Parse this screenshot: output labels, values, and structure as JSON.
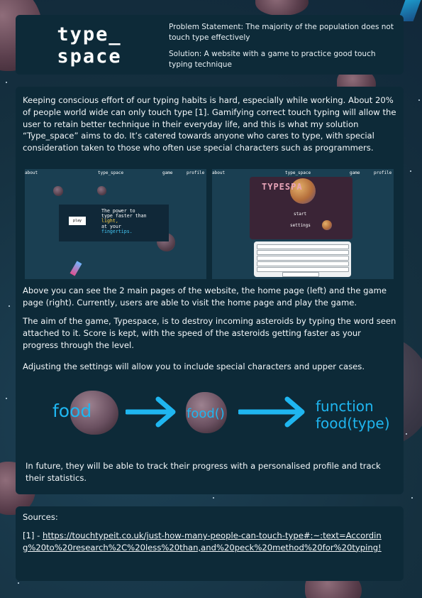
{
  "header": {
    "logo_line1": "type_",
    "logo_line2": "space",
    "problem": "Problem Statement: The majority of the population does not touch type effectively",
    "solution": "Solution: A website with a game to practice good touch typing technique"
  },
  "main": {
    "intro": "Keeping conscious effort of our typing habits is hard, especially while working.  About 20% of people world wide can only touch type [1]. Gamifying correct touch typing will allow the user to retain better technique in their everyday life, and this is what my solution “Type_space” aims to do. It’s catered towards anyone who cares to type, with special consideration taken to those who often use special characters such as programmers.",
    "home_shot": {
      "nav": [
        "about",
        "type_space",
        "game",
        "profile"
      ],
      "hero_line1": "The power to",
      "hero_line2": "type faster than",
      "hero_line3": "light,",
      "hero_line4": "at your",
      "hero_line5": "fingertips.",
      "play_button": "play"
    },
    "game_shot": {
      "nav": [
        "about",
        "type_space",
        "game",
        "profile"
      ],
      "title": "TYPESPA",
      "menu_start": "start",
      "menu_settings": "settings"
    },
    "para_pages": "Above you can see the 2 main pages of the website, the home page (left) and the game page (right). Currently, users are able to visit the home page and play the game.",
    "para_aim": "The aim of the game, Typespace, is to destroy incoming asteroids by typing the word seen attached to it. Score is kept, with the speed of the asteroids getting faster as your progress through the level.",
    "para_settings": "Adjusting the settings will allow you to include special characters and upper cases.",
    "flow": {
      "word1": "food",
      "word2": "food()",
      "word3_line1": "function",
      "word3_line2": "food(type)"
    },
    "para_future": "In future, they will be able to track their progress with a personalised profile and track their statistics."
  },
  "sources": {
    "title": "Sources:",
    "ref_prefix": "[1] - ",
    "ref_url": "https://touchtypeit.co.uk/just-how-many-people-can-touch-type#:~:text=According%20to%20research%2C%20less%20than,and%20peck%20method%20for%20typing!"
  },
  "colors": {
    "accent_cyan": "#1fb6f0",
    "panel": "#0d2a38",
    "background": "#18374a"
  }
}
